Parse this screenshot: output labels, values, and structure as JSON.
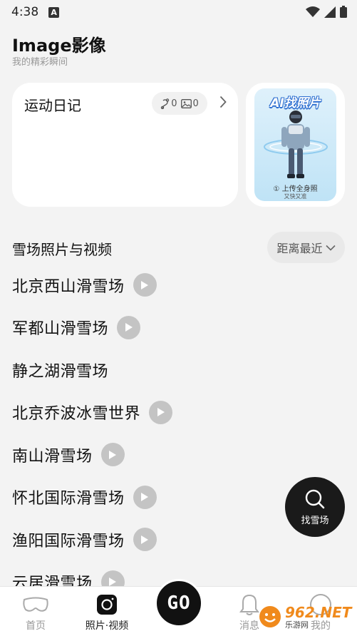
{
  "status_bar": {
    "time": "4:38",
    "notification_letter": "A"
  },
  "header": {
    "title": "Image影像",
    "subtitle": "我的精彩瞬间"
  },
  "diary_card": {
    "title": "运动日记",
    "tracks_count": "0",
    "photos_count": "0"
  },
  "ai_card": {
    "title": "AI找照片",
    "upload_label": "① 上传全身照",
    "tagline": "又快又准"
  },
  "section": {
    "title": "雪场照片与视频",
    "sort_label": "距离最近"
  },
  "resorts": [
    {
      "name": "北京西山滑雪场",
      "has_video": true
    },
    {
      "name": "军都山滑雪场",
      "has_video": true
    },
    {
      "name": "静之湖滑雪场",
      "has_video": false
    },
    {
      "name": "北京乔波冰雪世界",
      "has_video": true
    },
    {
      "name": "南山滑雪场",
      "has_video": true
    },
    {
      "name": "怀北国际滑雪场",
      "has_video": true
    },
    {
      "name": "渔阳国际滑雪场",
      "has_video": true
    },
    {
      "name": "云居滑雪场",
      "has_video": true
    }
  ],
  "find_button": {
    "label": "找雪场"
  },
  "tab_bar": {
    "tabs": [
      {
        "label": "首页",
        "icon": "goggles-icon"
      },
      {
        "label": "照片·视频",
        "icon": "camera-icon"
      },
      {
        "label": "消息",
        "icon": "bell-icon"
      },
      {
        "label": "我的",
        "icon": "profile-icon"
      }
    ],
    "go_label": "GO"
  },
  "watermark": {
    "brand": "962.NET",
    "sub": "乐游网"
  },
  "colors": {
    "background": "#f3f3f3",
    "card": "#ffffff",
    "accent_dark": "#111111",
    "play_gray": "#c4c4c4",
    "watermark_orange": "#f08a1c"
  }
}
